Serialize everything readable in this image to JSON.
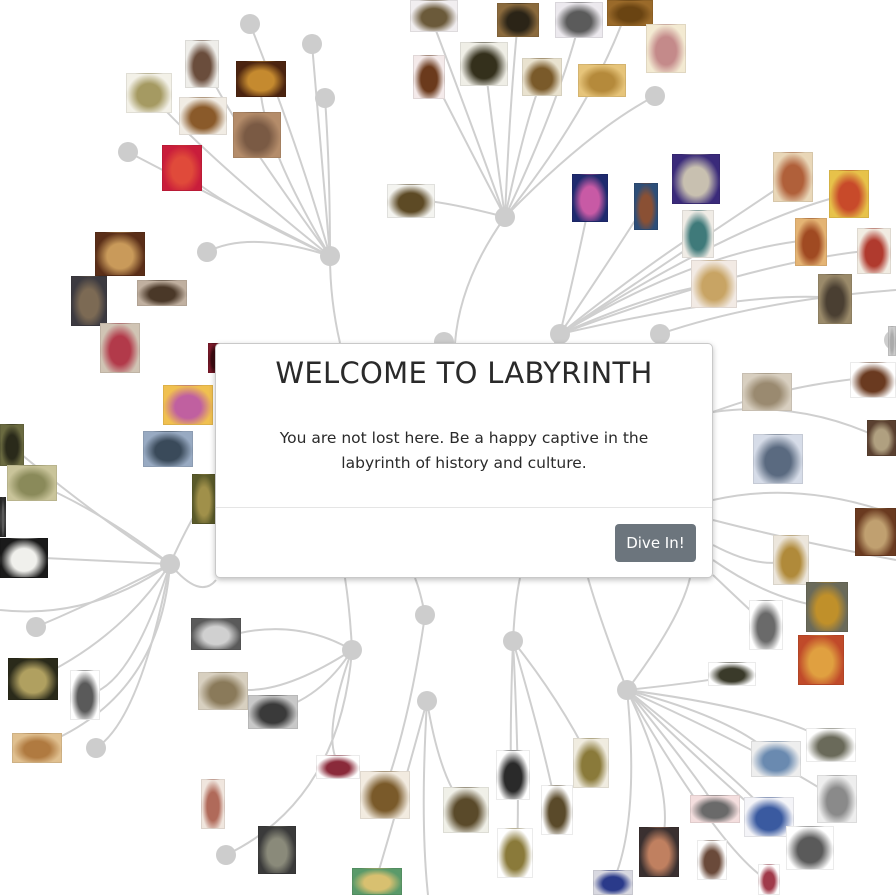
{
  "modal": {
    "title": "WELCOME TO LABYRINTH",
    "message": "You are not lost here. Be a happy captive in the labyrinth of history and culture.",
    "button_label": "Dive In!"
  },
  "graph": {
    "node_color": "#cdcdcd",
    "edge_color": "#cfcfcf",
    "artifact_thumbnail_count": 84
  }
}
